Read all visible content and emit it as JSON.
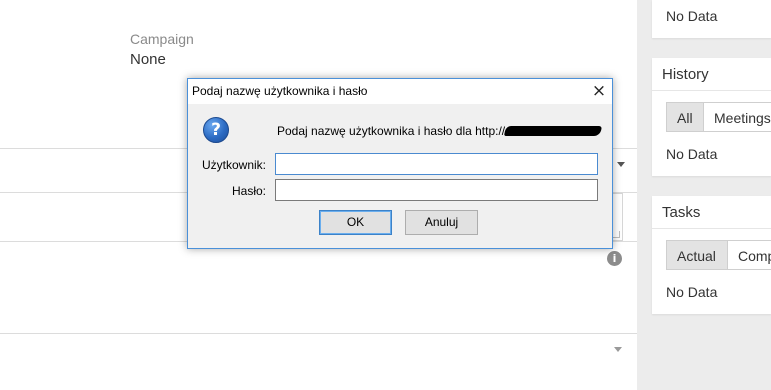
{
  "page": {
    "campaign": {
      "label": "Campaign",
      "value": "None"
    }
  },
  "right_rail": {
    "top_card": {
      "no_data": "No Data"
    },
    "history": {
      "title": "History",
      "filters": [
        "All",
        "Meetings"
      ],
      "no_data": "No Data"
    },
    "tasks": {
      "title": "Tasks",
      "filters": [
        "Actual",
        "Comp"
      ],
      "no_data": "No Data"
    }
  },
  "dialog": {
    "title": "Podaj nazwę użytkownika i hasło",
    "close_icon": "×",
    "question_icon": "?",
    "message": "Podaj nazwę użytkownika i hasło dla http://",
    "username_label": "Użytkownik:",
    "username_value": "",
    "password_label": "Hasło:",
    "password_value": "",
    "ok_label": "OK",
    "cancel_label": "Anuluj"
  },
  "icons": {
    "info": "i"
  },
  "colors": {
    "dialog_border": "#4a90d9",
    "question_icon": "#2c6bc3",
    "rail_background": "#ececec"
  }
}
